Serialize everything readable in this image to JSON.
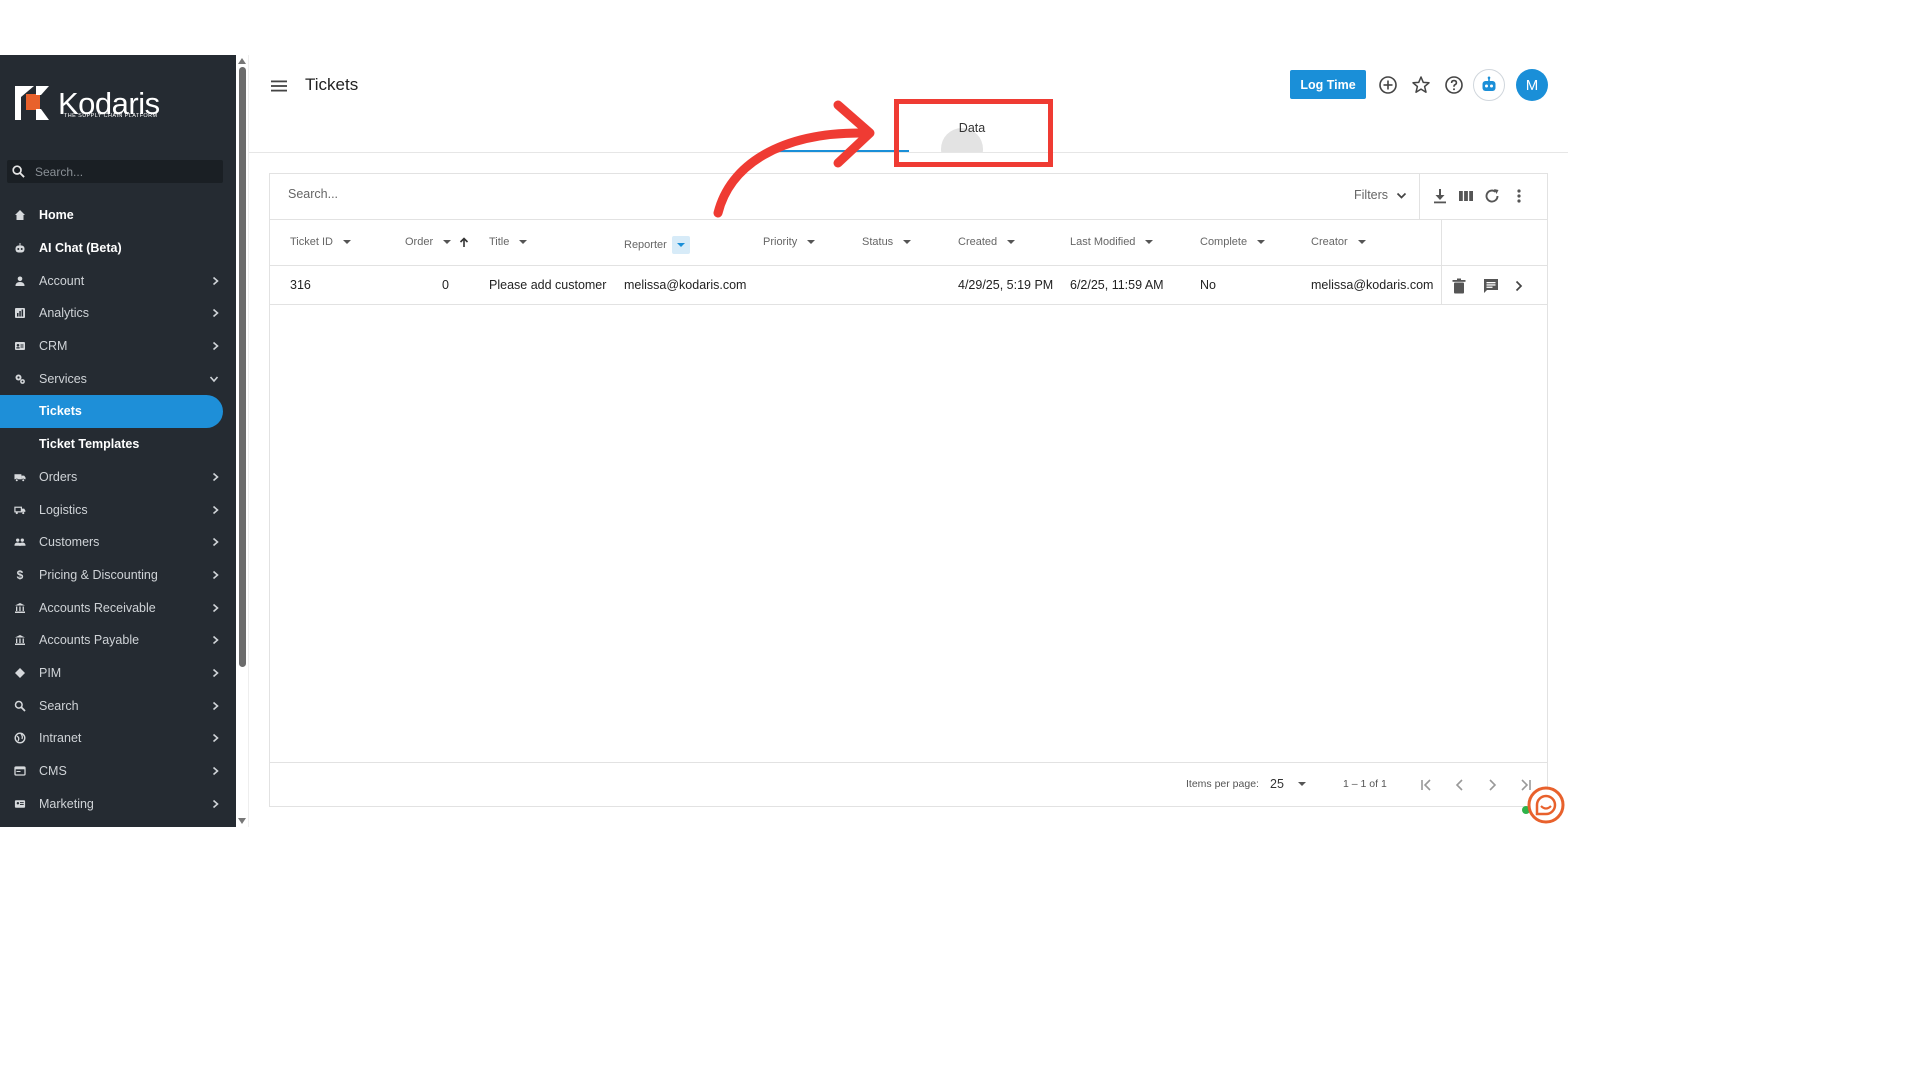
{
  "sidebar": {
    "logo_text": "Kodaris",
    "logo_tagline": "THE SUPPLY CHAIN PLATFORM",
    "search_placeholder": "Search...",
    "items": [
      {
        "label": "Home",
        "icon": "home-icon"
      },
      {
        "label": "AI Chat (Beta)",
        "icon": "robot-icon"
      },
      {
        "label": "Account",
        "icon": "person-icon"
      },
      {
        "label": "Analytics",
        "icon": "analytics-icon"
      },
      {
        "label": "CRM",
        "icon": "contact-card-icon"
      },
      {
        "label": "Services",
        "icon": "gears-icon"
      },
      {
        "label": "Tickets"
      },
      {
        "label": "Ticket Templates"
      },
      {
        "label": "Orders",
        "icon": "truck-icon"
      },
      {
        "label": "Logistics",
        "icon": "shipping-icon"
      },
      {
        "label": "Customers",
        "icon": "people-icon"
      },
      {
        "label": "Pricing & Discounting",
        "icon": "dollar-icon"
      },
      {
        "label": "Accounts Receivable",
        "icon": "bank-icon"
      },
      {
        "label": "Accounts Payable",
        "icon": "bank-icon"
      },
      {
        "label": "PIM",
        "icon": "tag-icon"
      },
      {
        "label": "Search",
        "icon": "search-icon"
      },
      {
        "label": "Intranet",
        "icon": "globe-icon"
      },
      {
        "label": "CMS",
        "icon": "cms-icon"
      },
      {
        "label": "Marketing",
        "icon": "megaphone-icon"
      }
    ]
  },
  "header": {
    "title": "Tickets",
    "log_time_label": "Log Time",
    "avatar_initial": "M",
    "tabs": [
      {
        "label": "Data"
      }
    ]
  },
  "table": {
    "search_placeholder": "Search...",
    "filters_label": "Filters",
    "columns": [
      "Ticket ID",
      "Order",
      "Title",
      "Reporter",
      "Priority",
      "Status",
      "Created",
      "Last Modified",
      "Complete",
      "Creator"
    ],
    "rows": [
      {
        "ticket_id": "316",
        "order": "0",
        "title": "Please add customer",
        "reporter": "melissa@kodaris.com",
        "priority": "",
        "status": "",
        "created": "4/29/25, 5:19 PM",
        "last_modified": "6/2/25, 11:59 AM",
        "complete": "No",
        "creator": "melissa@kodaris.com"
      }
    ],
    "footer": {
      "items_per_page_label": "Items per page:",
      "items_per_page": "25",
      "range": "1 – 1 of 1"
    }
  },
  "colors": {
    "sidebar_bg": "#252b32",
    "accent": "#1a8fd8",
    "annotation": "#ef3b33",
    "logo_orange": "#e8612c"
  }
}
